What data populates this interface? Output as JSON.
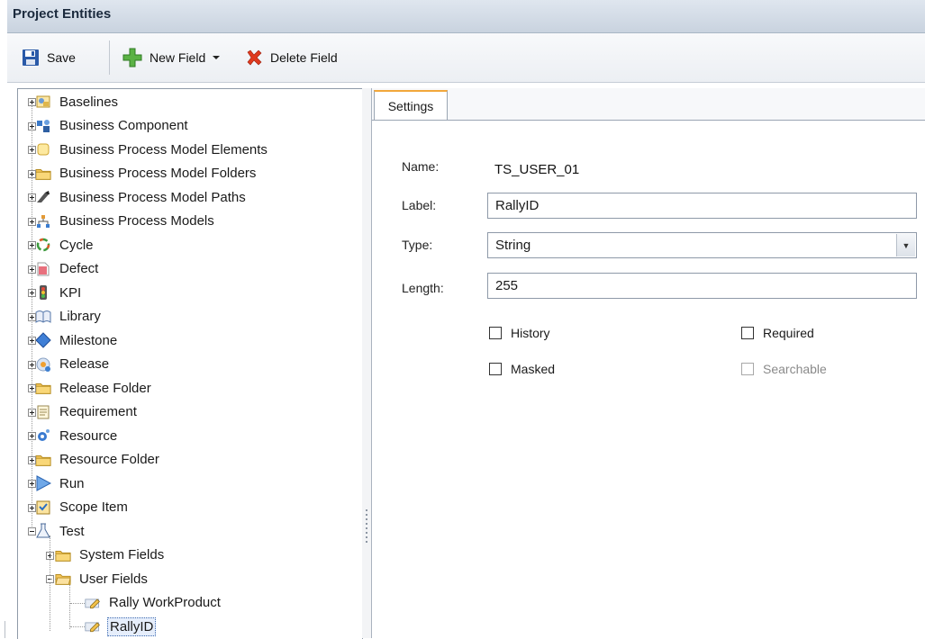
{
  "window": {
    "title": "Project Entities"
  },
  "toolbar": {
    "save_label": "Save",
    "new_field_label": "New Field",
    "delete_field_label": "Delete Field"
  },
  "tree": {
    "items": [
      {
        "label": "Baselines",
        "icon": "baselines-icon"
      },
      {
        "label": "Business Component",
        "icon": "business-component-icon"
      },
      {
        "label": "Business Process Model Elements",
        "icon": "bpm-elements-icon"
      },
      {
        "label": "Business Process Model Folders",
        "icon": "folder-icon"
      },
      {
        "label": "Business Process Model Paths",
        "icon": "bpm-paths-icon"
      },
      {
        "label": "Business Process Models",
        "icon": "bpm-models-icon"
      },
      {
        "label": "Cycle",
        "icon": "cycle-icon"
      },
      {
        "label": "Defect",
        "icon": "defect-icon"
      },
      {
        "label": "KPI",
        "icon": "kpi-icon"
      },
      {
        "label": "Library",
        "icon": "library-icon"
      },
      {
        "label": "Milestone",
        "icon": "milestone-icon"
      },
      {
        "label": "Release",
        "icon": "release-icon"
      },
      {
        "label": "Release Folder",
        "icon": "folder-icon"
      },
      {
        "label": "Requirement",
        "icon": "requirement-icon"
      },
      {
        "label": "Resource",
        "icon": "resource-icon"
      },
      {
        "label": "Resource Folder",
        "icon": "folder-icon"
      },
      {
        "label": "Run",
        "icon": "run-icon"
      },
      {
        "label": "Scope Item",
        "icon": "scope-item-icon"
      },
      {
        "label": "Test",
        "icon": "test-icon"
      }
    ],
    "test_children": [
      {
        "label": "System Fields",
        "icon": "folder-icon"
      },
      {
        "label": "User Fields",
        "icon": "folder-open-icon"
      }
    ],
    "user_fields_children": [
      {
        "label": "Rally WorkProduct",
        "icon": "field-edit-icon"
      },
      {
        "label": "RallyID",
        "icon": "field-edit-icon",
        "selected": true
      }
    ]
  },
  "settings": {
    "tab_label": "Settings",
    "name_label": "Name:",
    "name_value": "TS_USER_01",
    "label_label": "Label:",
    "label_value": "RallyID",
    "type_label": "Type:",
    "type_value": "String",
    "length_label": "Length:",
    "length_value": "255",
    "history_label": "History",
    "required_label": "Required",
    "masked_label": "Masked",
    "searchable_label": "Searchable"
  },
  "colors": {
    "accent_tab": "#f2a73b",
    "selection_border": "#3d6ab0",
    "folder": "#f5c65a"
  }
}
